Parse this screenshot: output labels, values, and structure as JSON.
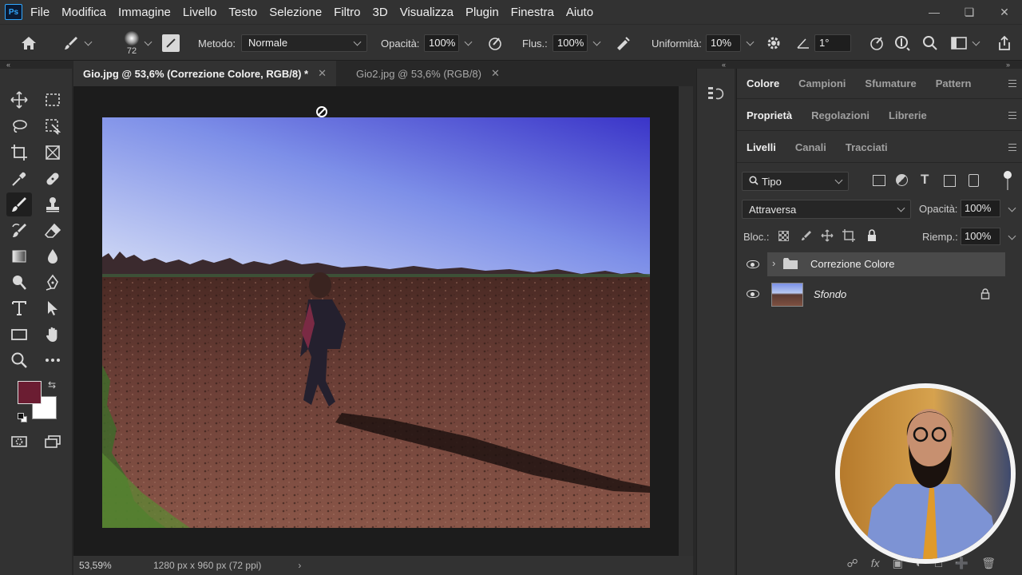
{
  "app": {
    "logo": "Ps",
    "menu": [
      "File",
      "Modifica",
      "Immagine",
      "Livello",
      "Testo",
      "Selezione",
      "Filtro",
      "3D",
      "Visualizza",
      "Plugin",
      "Finestra",
      "Aiuto"
    ]
  },
  "options": {
    "brush_size": "72",
    "method_label": "Metodo:",
    "method_value": "Normale",
    "opacity_label": "Opacità:",
    "opacity_value": "100%",
    "flow_label": "Flus.:",
    "flow_value": "100%",
    "smooth_label": "Uniformità:",
    "smooth_value": "10%",
    "angle_value": "1°"
  },
  "tabs": [
    {
      "label": "Gio.jpg @ 53,6% (Correzione Colore, RGB/8) *",
      "active": true
    },
    {
      "label": "Gio2.jpg @ 53,6% (RGB/8)",
      "active": false
    }
  ],
  "status": {
    "zoom": "53,59%",
    "doc_info": "1280 px x 960 px (72 ppi)"
  },
  "colors": {
    "foreground": "#6b1d32",
    "background": "#ffffff",
    "ui_bg": "#323232"
  },
  "panels": {
    "group1": [
      "Colore",
      "Campioni",
      "Sfumature",
      "Pattern"
    ],
    "group2": [
      "Proprietà",
      "Regolazioni",
      "Librerie"
    ],
    "group3": [
      "Livelli",
      "Canali",
      "Tracciati"
    ],
    "filter_kind": "Tipo",
    "blend_mode": "Attraversa",
    "layer_opacity_label": "Opacità:",
    "layer_opacity_value": "100%",
    "lock_label": "Bloc.:",
    "fill_label": "Riemp.:",
    "fill_value": "100%",
    "layers": [
      {
        "name": "Correzione Colore",
        "type": "group",
        "visible": true,
        "selected": true
      },
      {
        "name": "Sfondo",
        "type": "image",
        "visible": true,
        "locked": true
      }
    ]
  }
}
